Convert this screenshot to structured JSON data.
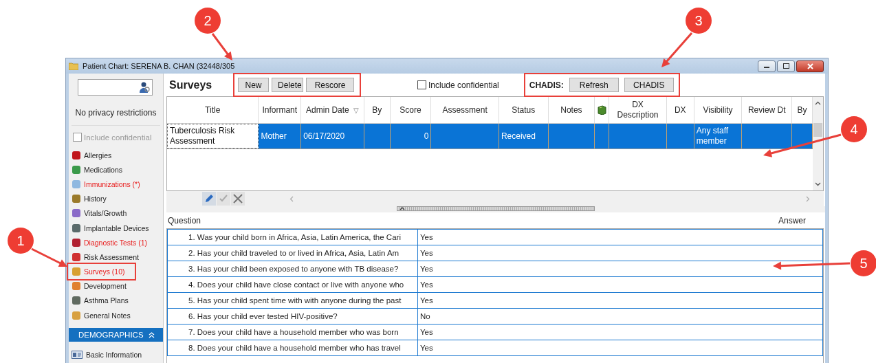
{
  "window": {
    "title": "Patient Chart: SERENA B. CHAN (32448/305"
  },
  "sidebar": {
    "privacy": "No privacy restrictions",
    "include_confidential": {
      "label": "Include confidential",
      "checked": false,
      "disabled": true
    },
    "items": [
      {
        "label": "Allergies",
        "alert": false
      },
      {
        "label": "Medications",
        "alert": false
      },
      {
        "label": "Immunizations (*)",
        "alert": true
      },
      {
        "label": "History",
        "alert": false
      },
      {
        "label": "Vitals/Growth",
        "alert": false
      },
      {
        "label": "Implantable Devices",
        "alert": false
      },
      {
        "label": "Diagnostic Tests (1)",
        "alert": true
      },
      {
        "label": "Risk Assessment",
        "alert": false
      },
      {
        "label": "Surveys (10)",
        "alert": true
      },
      {
        "label": "Development",
        "alert": false
      },
      {
        "label": "Asthma Plans",
        "alert": false
      },
      {
        "label": "General Notes",
        "alert": false
      }
    ],
    "section": {
      "label": "DEMOGRAPHICS",
      "expanded": true
    },
    "section_items": [
      {
        "label": "Basic Information"
      }
    ]
  },
  "surveys": {
    "title": "Surveys",
    "buttons": [
      "New",
      "Delete",
      "Rescore"
    ],
    "include_confidential": {
      "label": "Include confidential",
      "checked": false
    },
    "chadis": {
      "label": "CHADIS:",
      "buttons": [
        "Refresh",
        "CHADIS"
      ]
    }
  },
  "table": {
    "columns": [
      {
        "kind": "text",
        "label": "Title"
      },
      {
        "kind": "text",
        "label": "Informant"
      },
      {
        "kind": "text",
        "label": "Admin Date",
        "sort_indicator": "▽"
      },
      {
        "kind": "text",
        "label": "By"
      },
      {
        "kind": "text",
        "label": "Score"
      },
      {
        "kind": "text",
        "label": "Assessment"
      },
      {
        "kind": "text",
        "label": "Status"
      },
      {
        "kind": "text",
        "label": "Notes"
      },
      {
        "kind": "icon"
      },
      {
        "kind": "text",
        "label": "DX Description"
      },
      {
        "kind": "text",
        "label": "DX"
      },
      {
        "kind": "text",
        "label": "Visibility"
      },
      {
        "kind": "text",
        "label": "Review Dt"
      },
      {
        "kind": "text",
        "label": "By"
      }
    ],
    "rows": [
      {
        "selected": true,
        "cells": [
          "Tuberculosis Risk Assessment",
          "Mother",
          "06/17/2020",
          null,
          "0",
          null,
          "Received",
          null,
          null,
          null,
          null,
          "Any staff member",
          null,
          null
        ]
      }
    ]
  },
  "questions": {
    "question_label": "Question",
    "answer_label": "Answer",
    "rows": [
      {
        "question": "1. Was your child born in Africa, Asia, Latin America, the Cari",
        "answer": "Yes"
      },
      {
        "question": "2. Has your child traveled to or lived in Africa, Asia, Latin Am",
        "answer": "Yes"
      },
      {
        "question": "3. Has your child been exposed to anyone with TB disease?",
        "answer": "Yes"
      },
      {
        "question": "4. Does your child have close contact or live with anyone who",
        "answer": "Yes"
      },
      {
        "question": "5. Has your child spent time with with anyone during the past",
        "answer": "Yes"
      },
      {
        "question": "6. Has your child ever tested HIV-positive?",
        "answer": "No"
      },
      {
        "question": "7. Does your child have a household member who was born",
        "answer": "Yes"
      },
      {
        "question": "8. Does your child have a household member who has travel",
        "answer": "Yes"
      }
    ]
  },
  "annotations": [
    {
      "label": "1"
    },
    {
      "label": "2"
    },
    {
      "label": "3"
    },
    {
      "label": "4"
    },
    {
      "label": "5"
    }
  ]
}
